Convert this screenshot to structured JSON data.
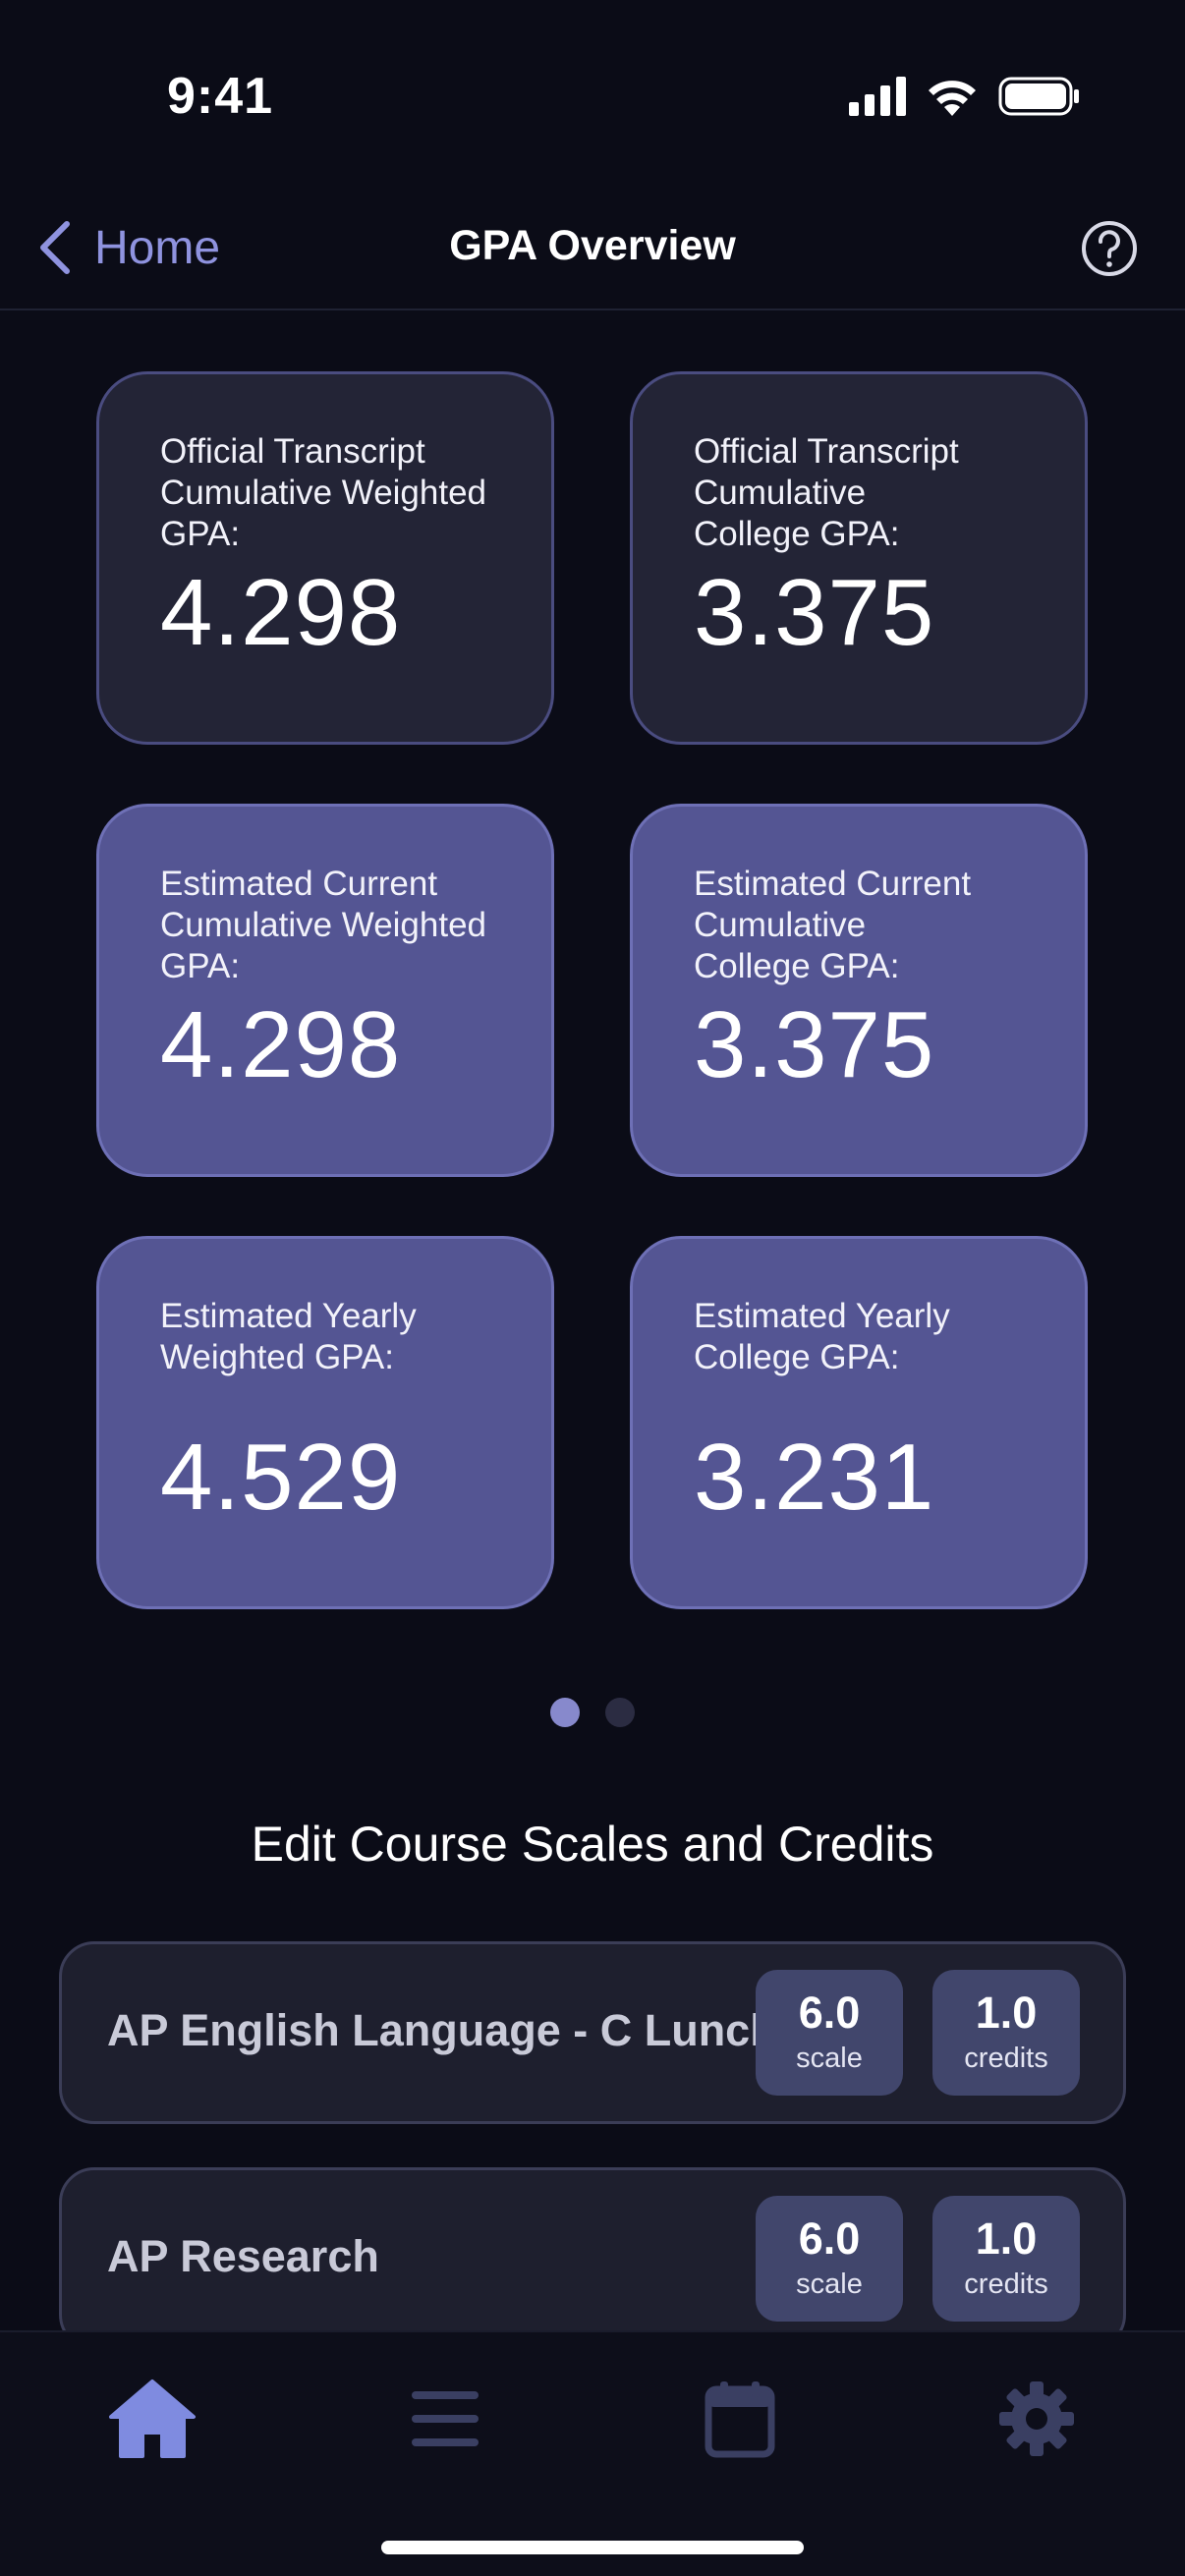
{
  "status_bar": {
    "time": "9:41"
  },
  "nav": {
    "back_label": "Home",
    "title": "GPA Overview"
  },
  "cards": [
    {
      "label": "Official Transcript\nCumulative Weighted\nGPA:",
      "value": "4.298"
    },
    {
      "label": "Official Transcript\nCumulative\nCollege GPA:",
      "value": "3.375"
    },
    {
      "label": "Estimated Current\nCumulative Weighted\nGPA:",
      "value": "4.298"
    },
    {
      "label": "Estimated Current\nCumulative\nCollege GPA:",
      "value": "3.375"
    },
    {
      "label": "Estimated Yearly\nWeighted GPA:",
      "value": "4.529"
    },
    {
      "label": "Estimated Yearly\nCollege GPA:",
      "value": "3.231"
    }
  ],
  "pager": {
    "pages": 2,
    "current": 1
  },
  "section_title": "Edit Course Scales and Credits",
  "courses": [
    {
      "name": "AP English Language - C Lunch",
      "scale": "6.0",
      "scale_unit": "scale",
      "credits": "1.0",
      "credits_unit": "credits"
    },
    {
      "name": "AP Research",
      "scale": "6.0",
      "scale_unit": "scale",
      "credits": "1.0",
      "credits_unit": "credits"
    }
  ],
  "tabs": [
    {
      "icon": "home-icon",
      "active": true
    },
    {
      "icon": "list-icon",
      "active": false
    },
    {
      "icon": "calendar-icon",
      "active": false
    },
    {
      "icon": "gear-icon",
      "active": false
    }
  ],
  "colors": {
    "accent": "#8f93df",
    "active_tab": "#7f8be0",
    "inactive_tab": "#3a3f62"
  }
}
